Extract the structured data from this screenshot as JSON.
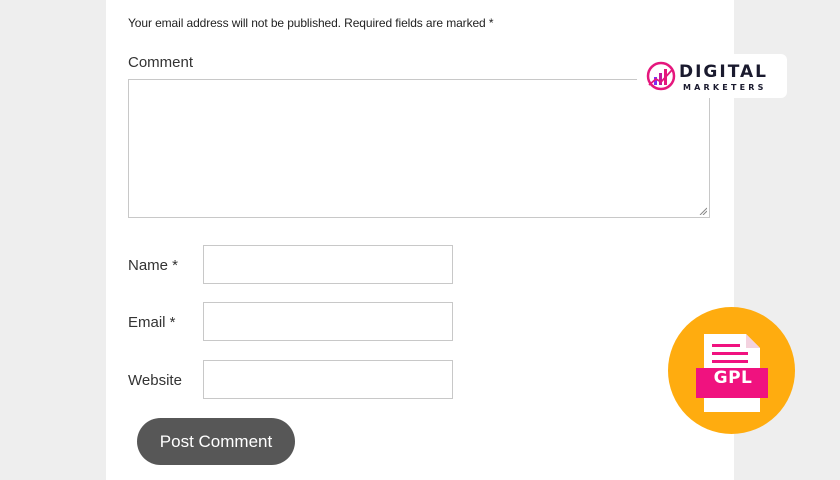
{
  "form": {
    "notice": "Your email address will not be published. Required fields are marked *",
    "comment_label": "Comment",
    "comment_value": "",
    "name_label": "Name *",
    "name_value": "",
    "email_label": "Email *",
    "email_value": "",
    "website_label": "Website",
    "website_value": "",
    "submit_label": "Post Comment"
  },
  "logo": {
    "line1": "DIGITAL",
    "line2": "MARKETERS",
    "icon": "bar-chart-logo-icon"
  },
  "badge": {
    "text": "GPL",
    "icon": "document-icon",
    "colors": {
      "circle": "#ffac0f",
      "label": "#f0127f"
    }
  },
  "colors": {
    "button": "#575757",
    "page_bg": "#eeeeee",
    "card_bg": "#ffffff"
  }
}
